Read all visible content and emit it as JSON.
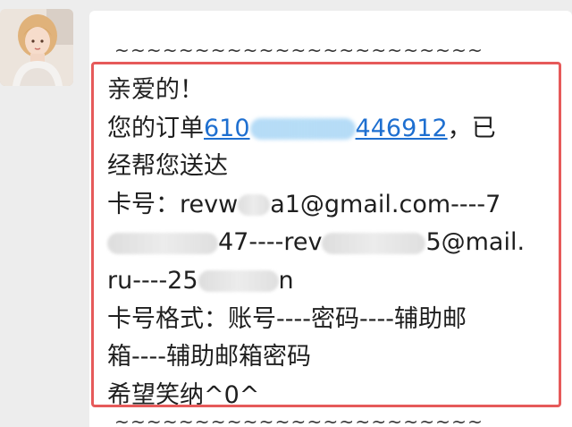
{
  "message": {
    "divider": "~~~~~~~~~~~~~~~~~~~~~~~",
    "greeting": "亲爱的！",
    "order_prefix": "您的订单",
    "order_id_start": "610",
    "order_id_end": "446912",
    "order_suffix": "，已",
    "delivered": "经帮您送达",
    "card_line_1": "卡号：revw",
    "card_line_1_b": "a1@gmail.com----7",
    "card_line_2_b": "47----rev",
    "card_line_2_c": "5@mail.",
    "card_line_3": "ru----25",
    "card_line_3_b": "n",
    "format_line_1": "卡号格式：账号----密码----辅助邮",
    "format_line_2": "箱----辅助邮箱密码",
    "closing": "希望笑纳^0^"
  },
  "colors": {
    "link": "#1e6fd0",
    "highlight_border": "#e65a5a",
    "bubble_background": "#ffffff",
    "chat_background": "#ededed"
  }
}
